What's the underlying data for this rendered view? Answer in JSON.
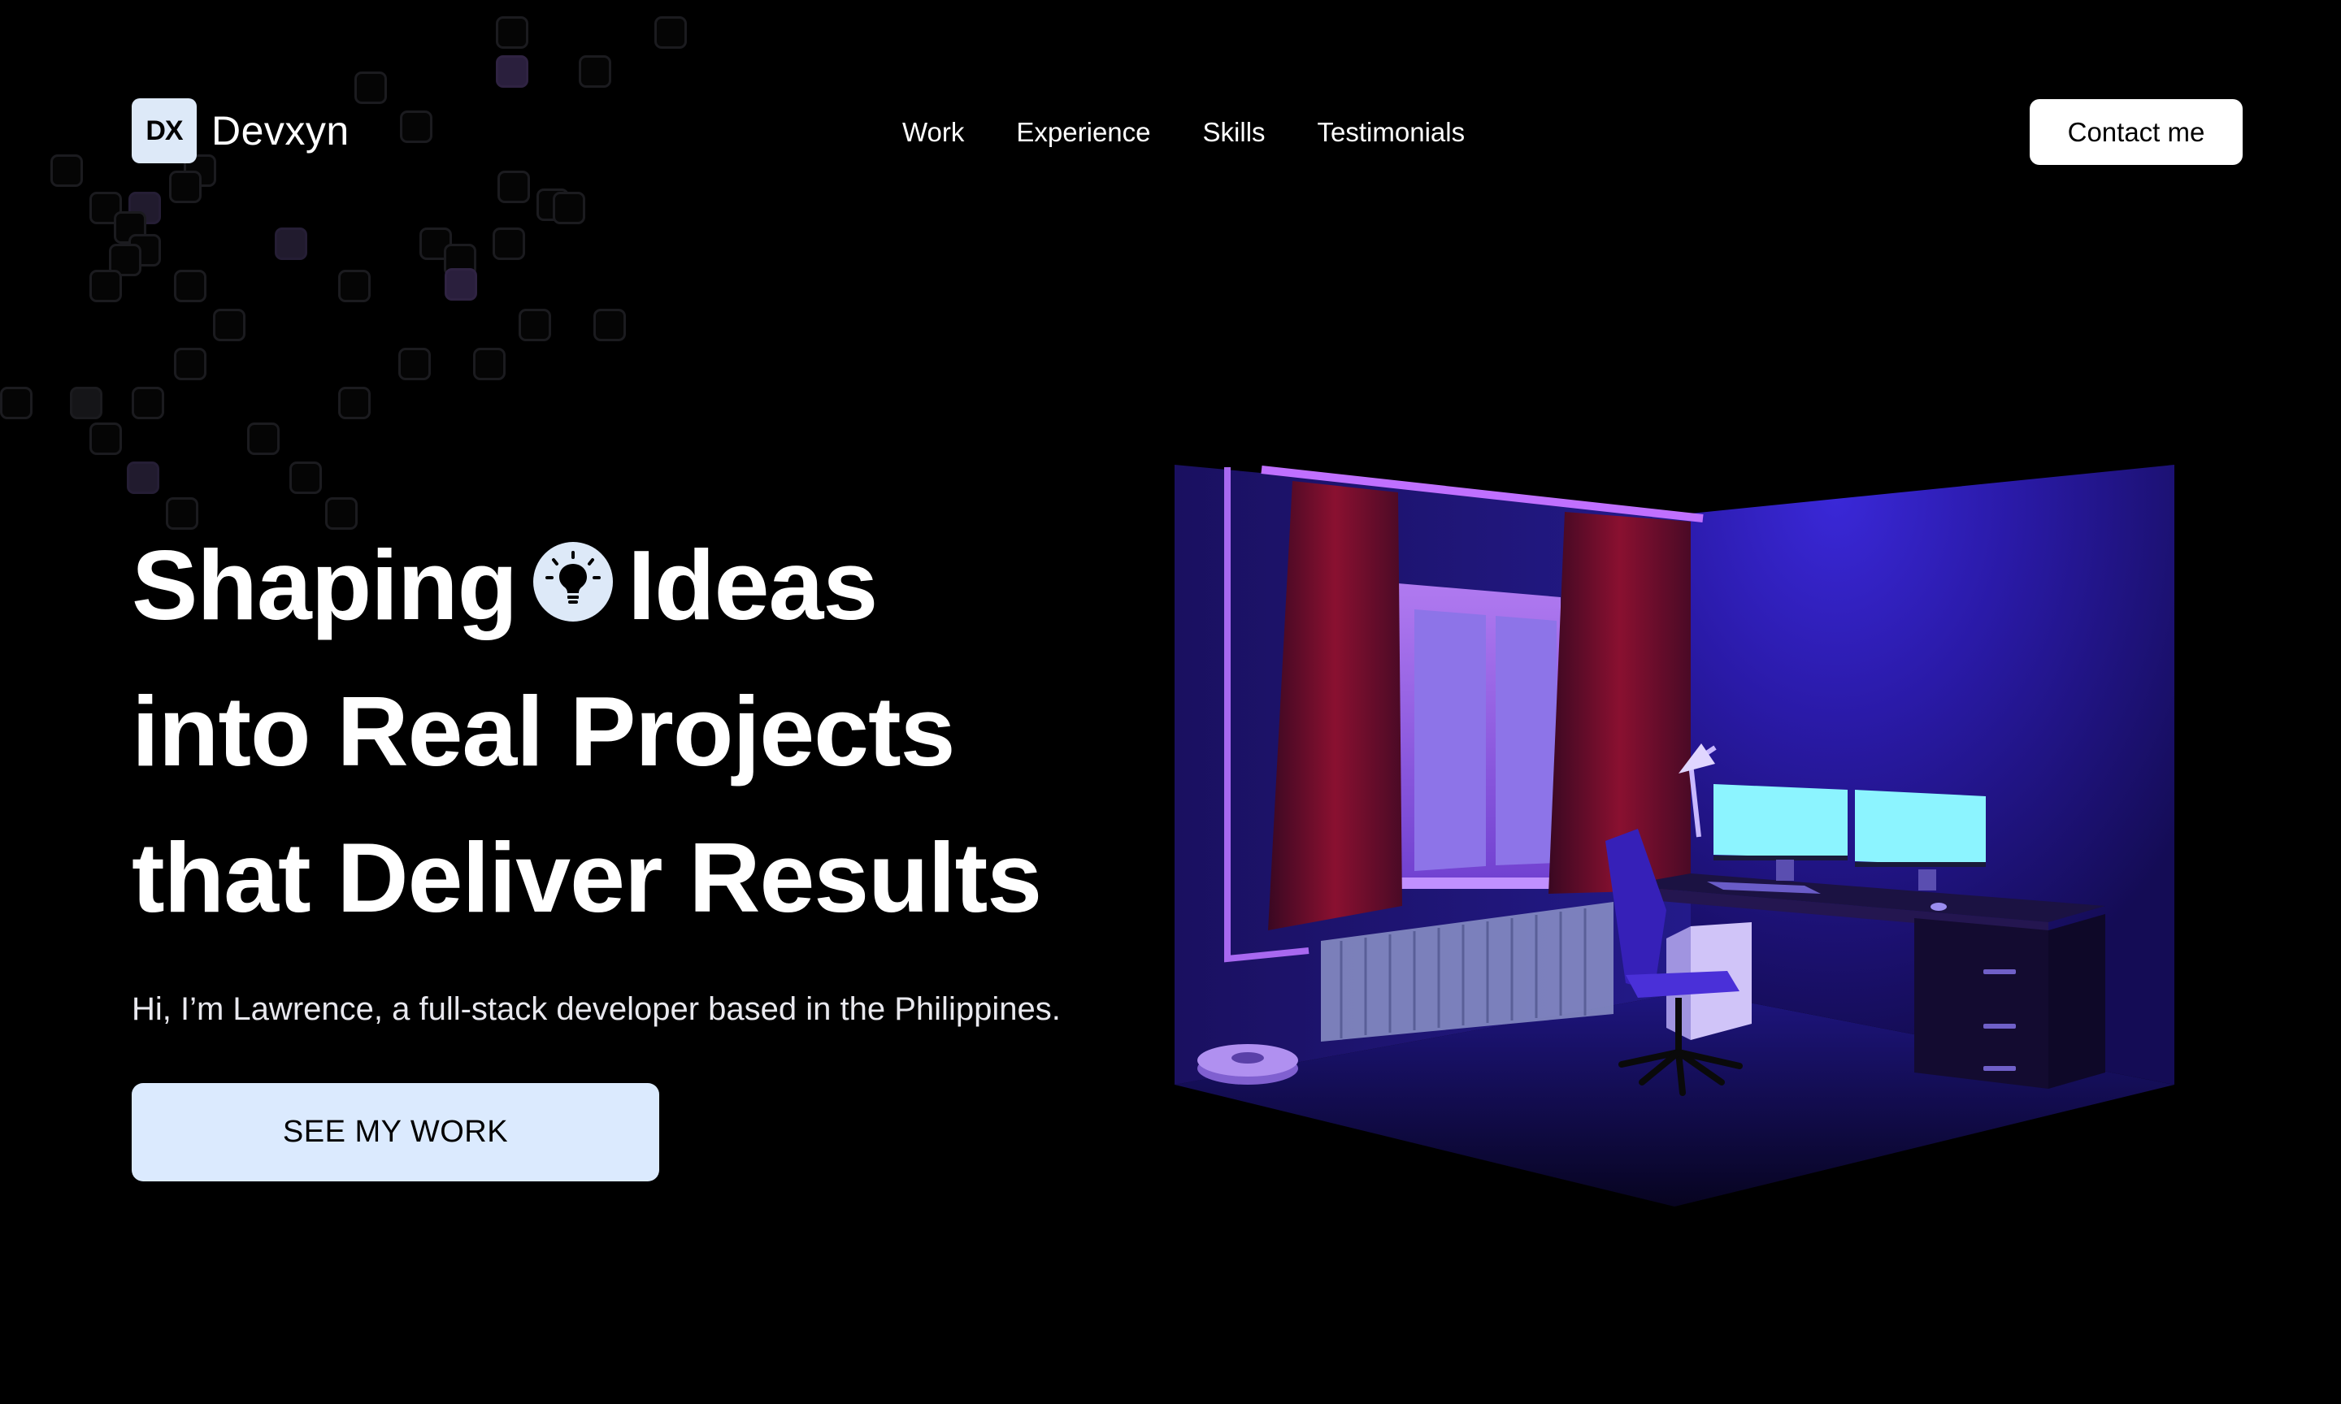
{
  "brand": {
    "mark": "DX",
    "name": "Devxyn"
  },
  "nav": {
    "items": [
      {
        "label": "Work"
      },
      {
        "label": "Experience"
      },
      {
        "label": "Skills"
      },
      {
        "label": "Testimonials"
      }
    ],
    "contact_label": "Contact me"
  },
  "hero": {
    "headline_line1_a": "Shaping",
    "headline_line1_b": "Ideas",
    "headline_line2": "into Real Projects",
    "headline_line3": "that Deliver Results",
    "subtitle": "Hi, I’m Lawrence, a full-stack developer based in the Philippines.",
    "cta_label": "SEE MY WORK",
    "headline_icon": "lightbulb-icon"
  },
  "illustration": {
    "name": "isometric-room-3d",
    "accent": "#3a1fb8"
  },
  "colors": {
    "background": "#000000",
    "accent_light": "#dbeafe",
    "text": "#ffffff"
  }
}
